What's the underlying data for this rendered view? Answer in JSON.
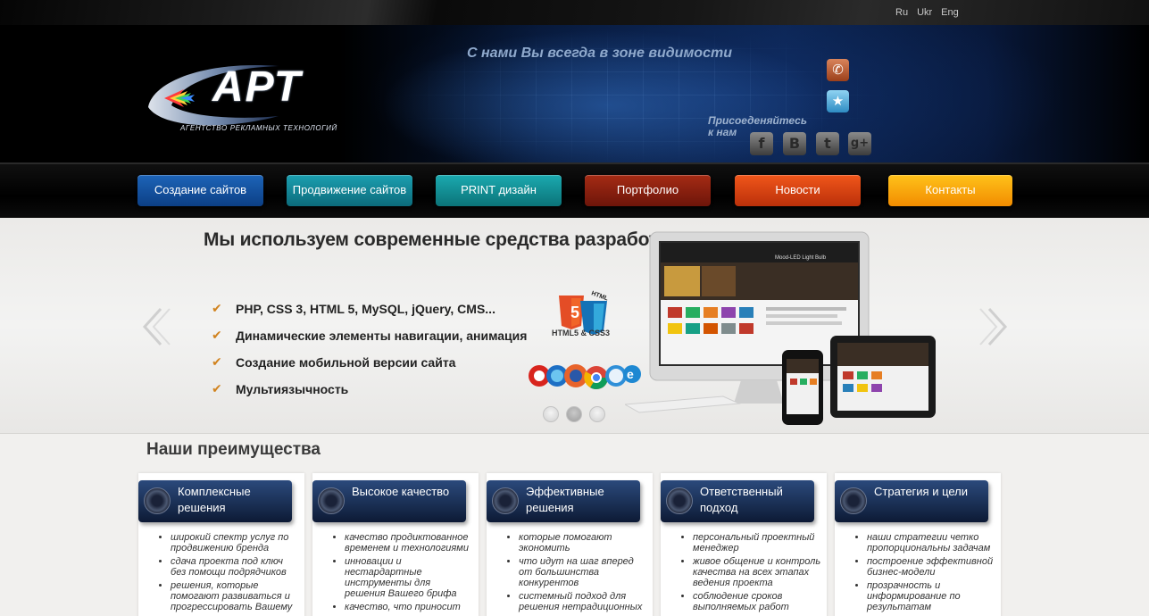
{
  "header": {
    "languages": [
      "Ru",
      "Ukr",
      "Eng"
    ],
    "logo_text": "АРТ",
    "logo_subtitle": "АГЕНТСТВО РЕКЛАМНЫХ ТЕХНОЛОГИЙ",
    "slogan": "С нами Вы всегда в зоне видимости",
    "join_text": "Присоеденяйтесь к нам",
    "icons": [
      "phone-icon",
      "star-icon",
      "facebook-icon",
      "vkontakte-icon",
      "twitter-icon",
      "google-plus-icon"
    ],
    "social_glyphs": {
      "facebook": "f",
      "vkontakte": "B",
      "twitter": "t",
      "google_plus": "g+"
    }
  },
  "nav": {
    "items": [
      {
        "label": "Создание сайтов",
        "color": "#1660b0"
      },
      {
        "label": "Продвижение сайтов",
        "color": "#1790a2"
      },
      {
        "label": "PRINT дизайн",
        "color": "#16a0a6"
      },
      {
        "label": "Портфолио",
        "color": "#8e200f"
      },
      {
        "label": "Новости",
        "color": "#e04d14"
      },
      {
        "label": "Контакты",
        "color": "#fbb413"
      }
    ]
  },
  "slider": {
    "title": "Мы используем современные средства разработки",
    "features": [
      "PHP, CSS 3, HTML 5, MySQL, jQuery, CMS...",
      "Динамические элементы навигации, анимация",
      "Создание мобильной версии сайта",
      "Мультиязычность"
    ],
    "html5_badge": "HTML",
    "html5_number": "5",
    "html5_label": "HTML5 & CSS3",
    "screen_caption": "Mood-LED Light Bulb",
    "slide_count": 3,
    "active_slide": 2
  },
  "advantages": {
    "title": "Наши преимущества",
    "cards": [
      {
        "title": "Комплексные решения",
        "items": [
          "широкий спектр услуг по продвижению бренда",
          "сдача проекта под ключ без помощи подрядчиков",
          "решения, которые помогают развиваться и прогрессировать Вашему"
        ]
      },
      {
        "title": "Высокое качество",
        "items": [
          "качество продиктованное временем и технологиями",
          "инновации и нестардартные инструменты для решения Вашего брифа",
          "качество, что приносит"
        ]
      },
      {
        "title": "Эффективные решения",
        "items": [
          "которые помогают экономить",
          "что идут на шаг вперед от большинства конкурентов",
          "системный подход для решения нетрадиционных"
        ]
      },
      {
        "title": "Ответственный подход",
        "items": [
          "персональный  проектный менеджер",
          "живое общение и контроль качества на всех этапах ведения проекта",
          "соблюдение сроков выполняемых работ"
        ]
      },
      {
        "title": "Стратегия и цели",
        "items": [
          "наши стратегии четко пропорциональны задачам",
          "построение эффективной бизнес-модели",
          "прозрачность и информирование по результатам"
        ]
      }
    ]
  }
}
